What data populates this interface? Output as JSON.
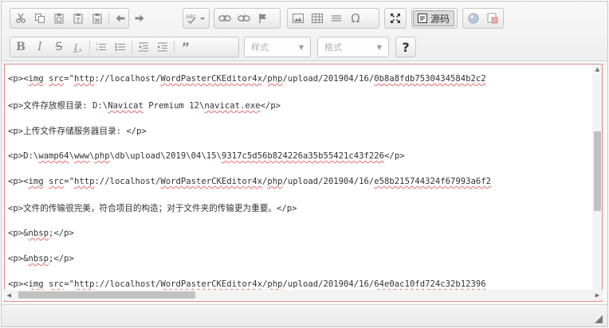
{
  "toolbar": {
    "row1": [
      {
        "icon": "cut-icon"
      },
      {
        "icon": "copy-icon"
      },
      {
        "icon": "paste-icon"
      },
      {
        "icon": "paste-text-icon"
      },
      {
        "icon": "paste-word-icon"
      },
      {
        "icon": "undo-icon"
      },
      {
        "icon": "redo-icon"
      },
      {
        "icon": "spellcheck-icon"
      },
      {
        "icon": "link-icon"
      },
      {
        "icon": "unlink-icon"
      },
      {
        "icon": "anchor-icon"
      },
      {
        "icon": "image-icon"
      },
      {
        "icon": "table-icon"
      },
      {
        "icon": "horizontal-rule-icon"
      },
      {
        "icon": "special-char-icon"
      },
      {
        "icon": "maximize-icon"
      },
      {
        "icon": "source-icon"
      },
      {
        "icon": "wordpaster-icon"
      },
      {
        "icon": "image-upload-icon"
      }
    ],
    "source_label": "源码",
    "styles_label": "样式",
    "format_label": "格式",
    "help_label": "?"
  },
  "editor": {
    "lines": [
      [
        {
          "t": "<p><"
        },
        {
          "t": "img",
          "u": true
        },
        {
          "t": " "
        },
        {
          "t": "src",
          "u": true
        },
        {
          "t": "=\""
        },
        {
          "t": "http",
          "u": true
        },
        {
          "t": "://localhost/"
        },
        {
          "t": "WordPasterCKEditor4x",
          "u": true
        },
        {
          "t": "/"
        },
        {
          "t": "php",
          "u": true
        },
        {
          "t": "/upload/201904/16/"
        },
        {
          "t": "0b8a8fdb7530434584b2c2",
          "u": true
        }
      ],
      [
        {
          "t": "<p>文件存放根目录: D:\\"
        },
        {
          "t": "Navicat",
          "u": true
        },
        {
          "t": " Premium 12\\"
        },
        {
          "t": "navicat.exe",
          "u": true
        },
        {
          "t": "</p>"
        }
      ],
      [
        {
          "t": "<p>上传文件存储服务器目录: </p>"
        }
      ],
      [
        {
          "t": "<p>D:\\"
        },
        {
          "t": "wamp64",
          "u": true
        },
        {
          "t": "\\"
        },
        {
          "t": "www",
          "u": true
        },
        {
          "t": "\\"
        },
        {
          "t": "php",
          "u": true
        },
        {
          "t": "\\db\\upload\\2019\\04\\15\\"
        },
        {
          "t": "9317c5d56b824226a35b55421c43f226",
          "u": true
        },
        {
          "t": "</p>"
        }
      ],
      [
        {
          "t": "<p><"
        },
        {
          "t": "img",
          "u": true
        },
        {
          "t": " "
        },
        {
          "t": "src",
          "u": true
        },
        {
          "t": "=\""
        },
        {
          "t": "http",
          "u": true
        },
        {
          "t": "://localhost/"
        },
        {
          "t": "WordPasterCKEditor4x",
          "u": true
        },
        {
          "t": "/"
        },
        {
          "t": "php",
          "u": true
        },
        {
          "t": "/upload/201904/16/"
        },
        {
          "t": "e58b215744324f67993a6f2",
          "u": true
        }
      ],
      [
        {
          "t": "<p>文件的传输很完美，符合项目的构造；对于文件夹的传输更为重要。</p>"
        }
      ],
      [
        {
          "t": "<p>&"
        },
        {
          "t": "nbsp",
          "u": true
        },
        {
          "t": ";</p>"
        }
      ],
      [
        {
          "t": "<p>&"
        },
        {
          "t": "nbsp",
          "u": true
        },
        {
          "t": ";</p>"
        }
      ],
      [
        {
          "t": "<p><"
        },
        {
          "t": "img",
          "u": true
        },
        {
          "t": " "
        },
        {
          "t": "src",
          "u": true
        },
        {
          "t": "=\""
        },
        {
          "t": "http",
          "u": true
        },
        {
          "t": "://localhost/"
        },
        {
          "t": "WordPasterCKEditor4x",
          "u": true
        },
        {
          "t": "/"
        },
        {
          "t": "php",
          "u": true
        },
        {
          "t": "/upload/201904/16/"
        },
        {
          "t": "64e0ac10fd724c32b12396",
          "u": true
        }
      ]
    ]
  },
  "colors": {
    "accent_border": "#e08a8a",
    "spell_underline": "#e36b6b"
  }
}
